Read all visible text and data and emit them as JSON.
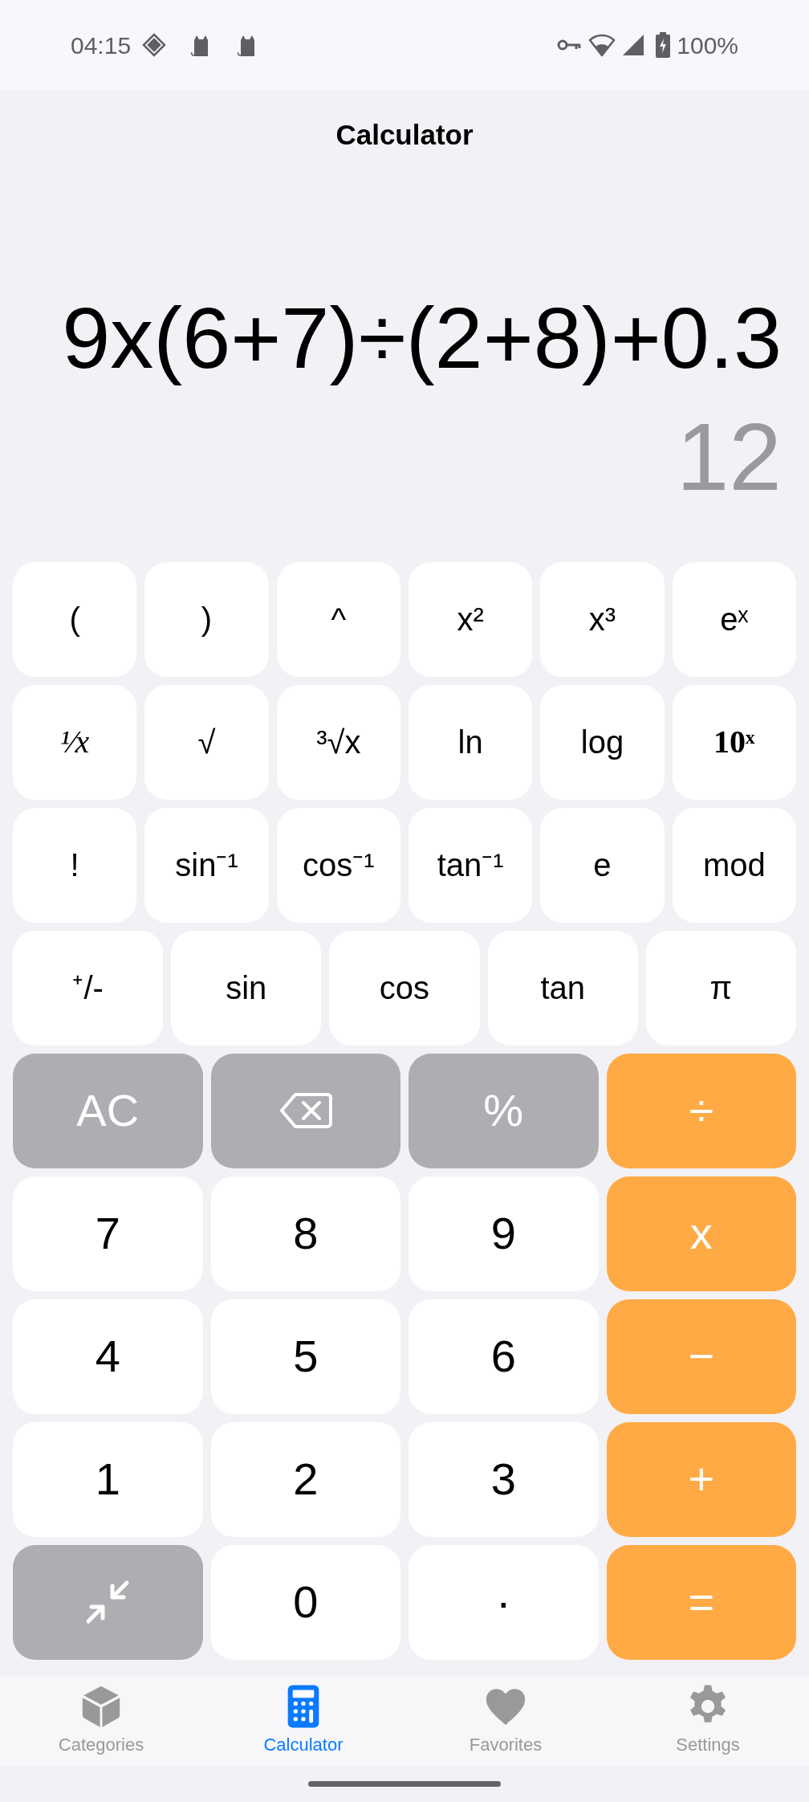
{
  "status_bar": {
    "time": "04:15",
    "battery": "100%"
  },
  "title": "Calculator",
  "display": {
    "expression": "9x(6+7)÷(2+8)+0.3",
    "result": "12"
  },
  "keypad": [
    [
      {
        "kind": "function",
        "label": "("
      },
      {
        "kind": "function",
        "label": ")"
      },
      {
        "kind": "function",
        "label": "^"
      },
      {
        "kind": "function",
        "label": "x²"
      },
      {
        "kind": "function",
        "label": "x³"
      },
      {
        "kind": "function",
        "label": "eˣ"
      }
    ],
    [
      {
        "kind": "reciprocal",
        "label": "¹⁄x"
      },
      {
        "kind": "function",
        "label": "√"
      },
      {
        "kind": "function",
        "label": "³√x"
      },
      {
        "kind": "function",
        "label": "ln"
      },
      {
        "kind": "function",
        "label": "log"
      },
      {
        "kind": "power-of-ten",
        "label": "10ˣ"
      }
    ],
    [
      {
        "kind": "function",
        "label": "!"
      },
      {
        "kind": "function",
        "label": "sin⁻¹"
      },
      {
        "kind": "function",
        "label": "cos⁻¹"
      },
      {
        "kind": "function",
        "label": "tan⁻¹"
      },
      {
        "kind": "function",
        "label": "e"
      },
      {
        "kind": "function",
        "label": "mod"
      }
    ],
    [
      {
        "kind": "function",
        "label": "⁺/-"
      },
      {
        "kind": "function",
        "label": "sin"
      },
      {
        "kind": "function",
        "label": "cos"
      },
      {
        "kind": "function",
        "label": "tan"
      },
      {
        "kind": "function",
        "label": "π"
      }
    ],
    [
      {
        "kind": "utility",
        "label": "AC"
      },
      {
        "kind": "backspace"
      },
      {
        "kind": "utility",
        "label": "%"
      },
      {
        "kind": "operator",
        "label": "÷"
      }
    ],
    [
      {
        "kind": "digit",
        "label": "7"
      },
      {
        "kind": "digit",
        "label": "8"
      },
      {
        "kind": "digit",
        "label": "9"
      },
      {
        "kind": "operator",
        "label": "x"
      }
    ],
    [
      {
        "kind": "digit",
        "label": "4"
      },
      {
        "kind": "digit",
        "label": "5"
      },
      {
        "kind": "digit",
        "label": "6"
      },
      {
        "kind": "operator",
        "label": "−"
      }
    ],
    [
      {
        "kind": "digit",
        "label": "1"
      },
      {
        "kind": "digit",
        "label": "2"
      },
      {
        "kind": "digit",
        "label": "3"
      },
      {
        "kind": "operator",
        "label": "+"
      }
    ],
    [
      {
        "kind": "collapse"
      },
      {
        "kind": "digit",
        "label": "0"
      },
      {
        "kind": "digit",
        "label": "·"
      },
      {
        "kind": "operator",
        "label": "="
      }
    ]
  ],
  "tabs": [
    {
      "label": "Categories",
      "selected": false,
      "kind": "cube"
    },
    {
      "label": "Calculator",
      "selected": true,
      "kind": "calculator"
    },
    {
      "label": "Favorites",
      "selected": false,
      "kind": "heart"
    },
    {
      "label": "Settings",
      "selected": false,
      "kind": "gear"
    }
  ]
}
